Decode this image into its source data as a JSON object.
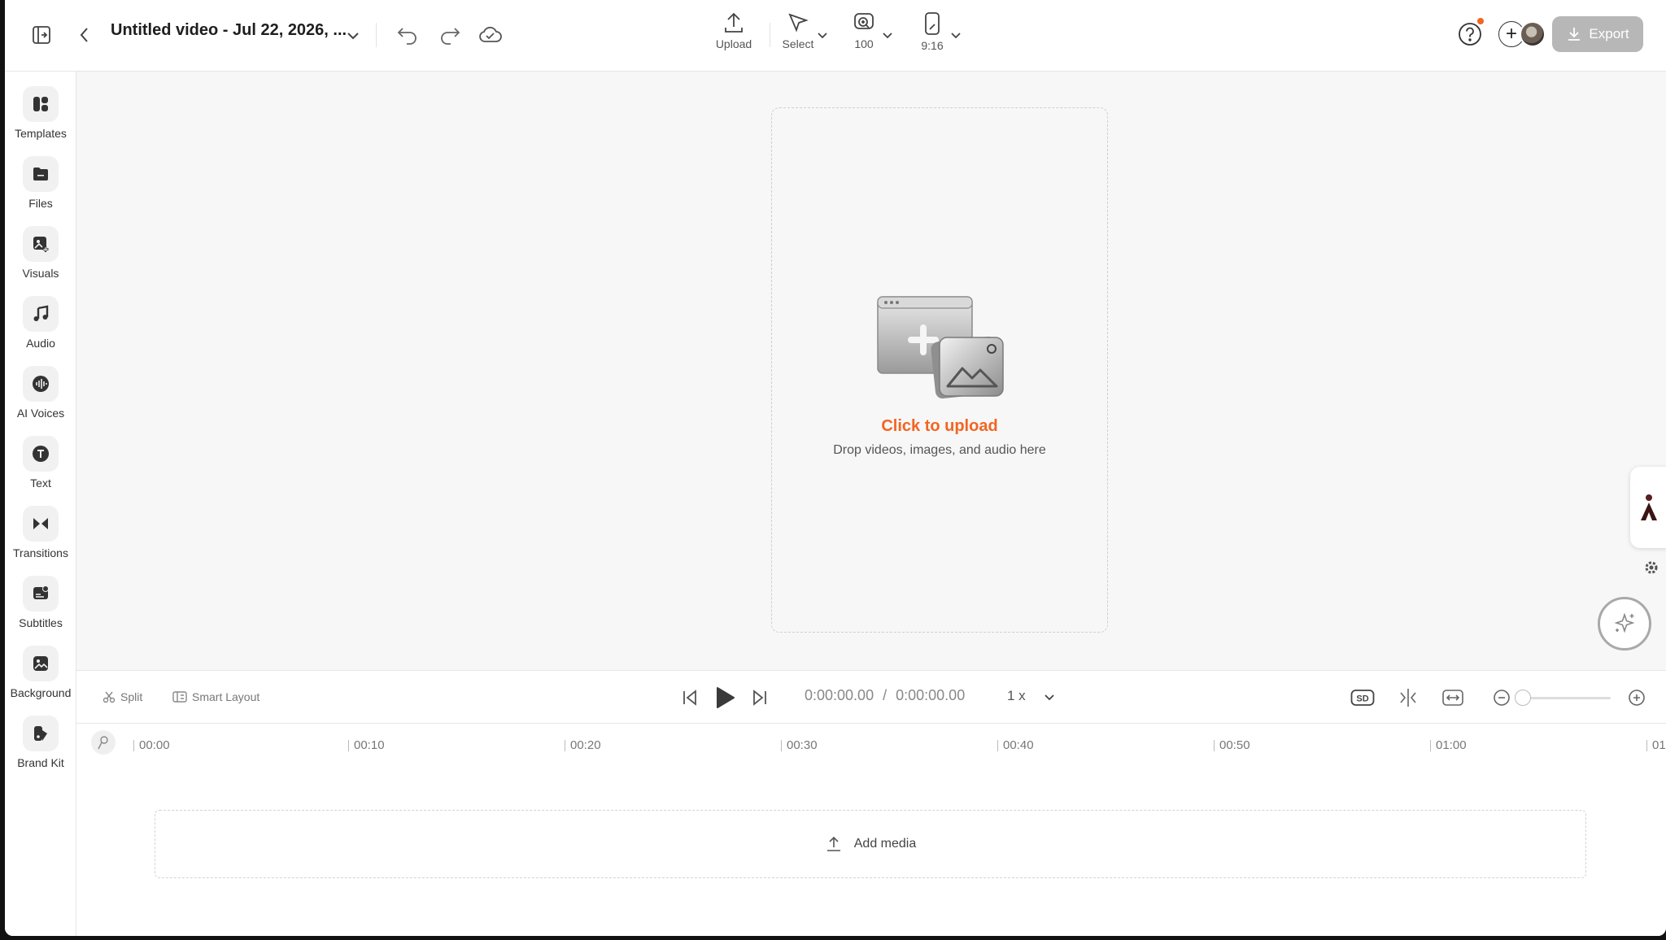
{
  "header": {
    "title": "Untitled video - Jul 22, 2026, ...",
    "tools": {
      "upload": "Upload",
      "select": "Select",
      "zoom": "100",
      "aspect": "9:16"
    },
    "export_label": "Export",
    "notification_dot_color": "#f26522"
  },
  "sidebar": {
    "items": [
      {
        "label": "Templates",
        "icon": "templates-icon"
      },
      {
        "label": "Files",
        "icon": "folder-icon"
      },
      {
        "label": "Visuals",
        "icon": "image-plus-icon"
      },
      {
        "label": "Audio",
        "icon": "music-note-icon"
      },
      {
        "label": "AI Voices",
        "icon": "waveform-icon"
      },
      {
        "label": "Text",
        "icon": "text-icon"
      },
      {
        "label": "Transitions",
        "icon": "bowtie-icon"
      },
      {
        "label": "Subtitles",
        "icon": "subtitles-icon"
      },
      {
        "label": "Background",
        "icon": "background-image-icon"
      },
      {
        "label": "Brand Kit",
        "icon": "brand-kit-icon"
      }
    ]
  },
  "canvas": {
    "upload_title": "Click to upload",
    "upload_subtitle": "Drop videos, images, and audio here",
    "accent_color": "#f26522"
  },
  "controls": {
    "split": "Split",
    "smart_layout": "Smart Layout",
    "current_time": "0:00:00.00",
    "separator": "/",
    "total_time": "0:00:00.00",
    "speed": "1 x",
    "quality_badge": "SD"
  },
  "timeline": {
    "ticks": [
      "00:00",
      "00:10",
      "00:20",
      "00:30",
      "00:40",
      "00:50",
      "01:00",
      "01"
    ],
    "add_media": "Add media"
  }
}
